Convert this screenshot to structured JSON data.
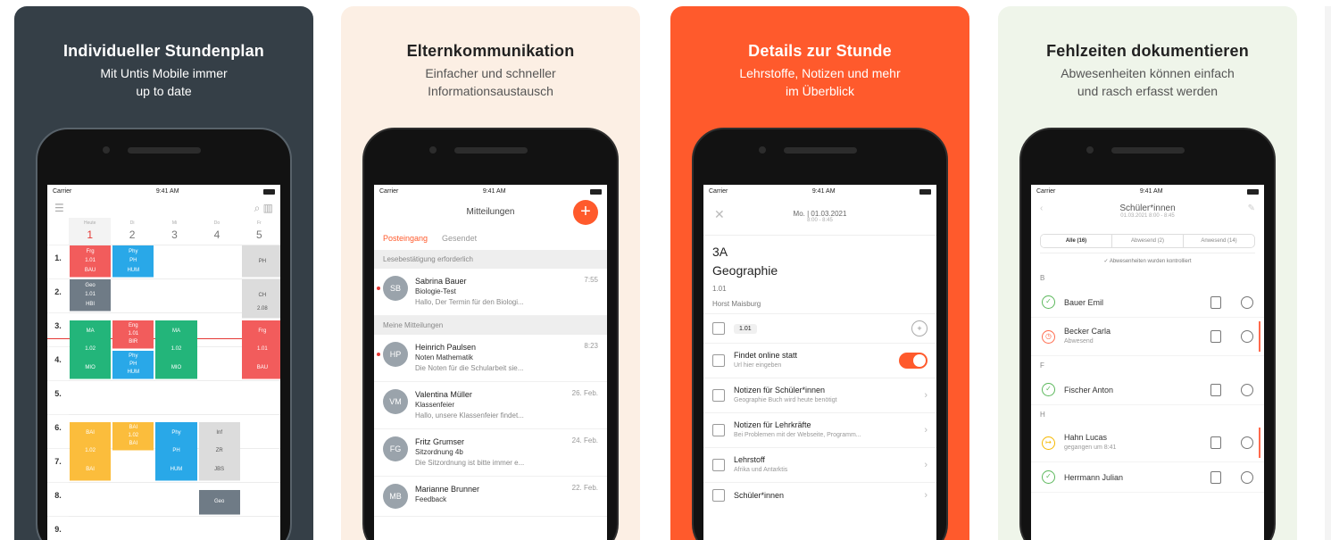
{
  "panels": {
    "p1": {
      "title": "Individueller Stundenplan",
      "sub1": "Mit Untis Mobile immer",
      "sub2": "up to date"
    },
    "p2": {
      "title": "Elternkommunikation",
      "sub1": "Einfacher und schneller",
      "sub2": "Informationsaustausch"
    },
    "p3": {
      "title": "Details zur Stunde",
      "sub1": "Lehrstoffe, Notizen und mehr",
      "sub2": "im Überblick"
    },
    "p4": {
      "title": "Fehlzeiten dokumentieren",
      "sub1": "Abwesenheiten können einfach",
      "sub2": "und rasch erfasst werden"
    }
  },
  "status": {
    "carrier": "Carrier",
    "time": "9:41 AM"
  },
  "timetable": {
    "days": [
      {
        "num": "1",
        "lbl": "Heute",
        "current": true
      },
      {
        "num": "2",
        "lbl": "Di"
      },
      {
        "num": "3",
        "lbl": "Mi"
      },
      {
        "num": "4",
        "lbl": "Do"
      },
      {
        "num": "5",
        "lbl": "Fr"
      }
    ],
    "slots": [
      "1.",
      "2.",
      "3.",
      "4.",
      "5.",
      "6.",
      "7.",
      "8.",
      "9."
    ],
    "blocks": [
      {
        "day": 0,
        "start": 0,
        "len": 1,
        "color": "#f25c5c",
        "lines": [
          "Frg",
          "1.01",
          "BAU"
        ]
      },
      {
        "day": 1,
        "start": 0,
        "len": 1,
        "color": "#29a8e8",
        "lines": [
          "Phy",
          "PH",
          "HUM"
        ]
      },
      {
        "day": 4,
        "start": 0,
        "len": 1,
        "color": "#dcdcdc",
        "lines": [
          "PH"
        ]
      },
      {
        "day": 4,
        "start": 1,
        "len": 1,
        "color": "#dcdcdc",
        "lines": [
          "CH"
        ]
      },
      {
        "day": 0,
        "start": 1,
        "len": 1,
        "color": "#6f7b86",
        "lines": [
          "Geo",
          "1.01",
          "HBI"
        ]
      },
      {
        "day": 4,
        "start": 1.6,
        "len": 0.6,
        "color": "#dcdcdc",
        "lines": [
          "2.08"
        ]
      },
      {
        "day": 0,
        "start": 2.2,
        "len": 1.8,
        "color": "#23b57a",
        "lines": [
          "MA",
          "1.02",
          "MIO"
        ]
      },
      {
        "day": 1,
        "start": 2.2,
        "len": 0.9,
        "color": "#f25c5c",
        "lines": [
          "Eng",
          "1.01",
          "BIR"
        ]
      },
      {
        "day": 2,
        "start": 2.2,
        "len": 1.8,
        "color": "#23b57a",
        "lines": [
          "MA",
          "1.02",
          "MIO"
        ]
      },
      {
        "day": 4,
        "start": 2.2,
        "len": 1.8,
        "color": "#f25c5c",
        "lines": [
          "Frg",
          "1.01",
          "BAU"
        ]
      },
      {
        "day": 1,
        "start": 3.1,
        "len": 0.9,
        "color": "#29a8e8",
        "lines": [
          "Phy",
          "PH",
          "HUM"
        ]
      },
      {
        "day": 0,
        "start": 5.2,
        "len": 1.8,
        "color": "#fbbd3c",
        "lines": [
          "BAI",
          "1.02",
          "BAI"
        ]
      },
      {
        "day": 1,
        "start": 5.2,
        "len": 0.9,
        "color": "#fbbd3c",
        "lines": [
          "BAI",
          "1.02",
          "BAI"
        ]
      },
      {
        "day": 2,
        "start": 5.2,
        "len": 1.8,
        "color": "#29a8e8",
        "lines": [
          "Phy",
          "PH",
          "HUM"
        ]
      },
      {
        "day": 3,
        "start": 5.2,
        "len": 1.8,
        "color": "#dcdcdc",
        "lines": [
          "Inf",
          "ZR",
          "JBS"
        ]
      },
      {
        "day": 3,
        "start": 7.2,
        "len": 0.8,
        "color": "#6f7b86",
        "lines": [
          "Geo"
        ]
      }
    ]
  },
  "messages": {
    "title": "Mitteilungen",
    "tab_inbox": "Posteingang",
    "tab_sent": "Gesendet",
    "sec_confirm": "Lesebestätigung erforderlich",
    "sec_mine": "Meine Mitteilungen",
    "list_top": [
      {
        "av": "SB",
        "name": "Sabrina Bauer",
        "subject": "Biologie-Test",
        "preview": "Hallo, Der Termin für den Biologi...",
        "time": "7:55",
        "unread": true
      }
    ],
    "list": [
      {
        "av": "HP",
        "name": "Heinrich Paulsen",
        "subject": "Noten Mathematik",
        "preview": "Die Noten für die Schularbeit sie...",
        "time": "8:23",
        "unread": true
      },
      {
        "av": "VM",
        "name": "Valentina Müller",
        "subject": "Klassenfeier",
        "preview": "Hallo, unsere Klassenfeier findet...",
        "time": "26. Feb.",
        "unread": false
      },
      {
        "av": "FG",
        "name": "Fritz Grumser",
        "subject": "Sitzordnung 4b",
        "preview": "Die Sitzordnung ist bitte immer e...",
        "time": "24. Feb.",
        "unread": false
      },
      {
        "av": "MB",
        "name": "Marianne Brunner",
        "subject": "Feedback",
        "preview": "",
        "time": "22. Feb.",
        "unread": false
      }
    ]
  },
  "details": {
    "date": "Mo. | 01.03.2021",
    "timerange": "8:00 - 8:45",
    "cls": "3A",
    "subject": "Geographie",
    "room": "1.01",
    "teacher": "Horst Maisburg",
    "room_tag": "1.01",
    "rows": [
      {
        "title": "Findet online statt",
        "sub": "Url hier eingeben",
        "control": "toggle"
      },
      {
        "title": "Notizen für Schüler*innen",
        "sub": "Geographie Buch wird heute benötigt",
        "control": "chev"
      },
      {
        "title": "Notizen für Lehrkräfte",
        "sub": "Bei Problemen mit der Webseite, Programm...",
        "control": "chev"
      },
      {
        "title": "Lehrstoff",
        "sub": "Afrika und Antarktis",
        "control": "chev"
      },
      {
        "title": "Schüler*innen",
        "sub": "",
        "control": "chev"
      }
    ]
  },
  "absences": {
    "title": "Schüler*innen",
    "date": "01.03.2021 8:00 - 8:45",
    "seg": [
      "Alle (16)",
      "Abwesend (2)",
      "Anwesend (14)"
    ],
    "note": "✓ Abwesenheiten wurden kontrolliert",
    "groups": [
      {
        "letter": "B",
        "items": [
          {
            "name": "Bauer Emil",
            "sub": "",
            "state": "ok"
          },
          {
            "name": "Becker Carla",
            "sub": "Abwesend",
            "state": "absent"
          }
        ]
      },
      {
        "letter": "F",
        "items": [
          {
            "name": "Fischer Anton",
            "sub": "",
            "state": "ok"
          }
        ]
      },
      {
        "letter": "H",
        "items": [
          {
            "name": "Hahn Lucas",
            "sub": "gegangen um 8:41",
            "state": "late"
          },
          {
            "name": "Herrmann Julian",
            "sub": "",
            "state": "ok"
          }
        ]
      }
    ]
  }
}
